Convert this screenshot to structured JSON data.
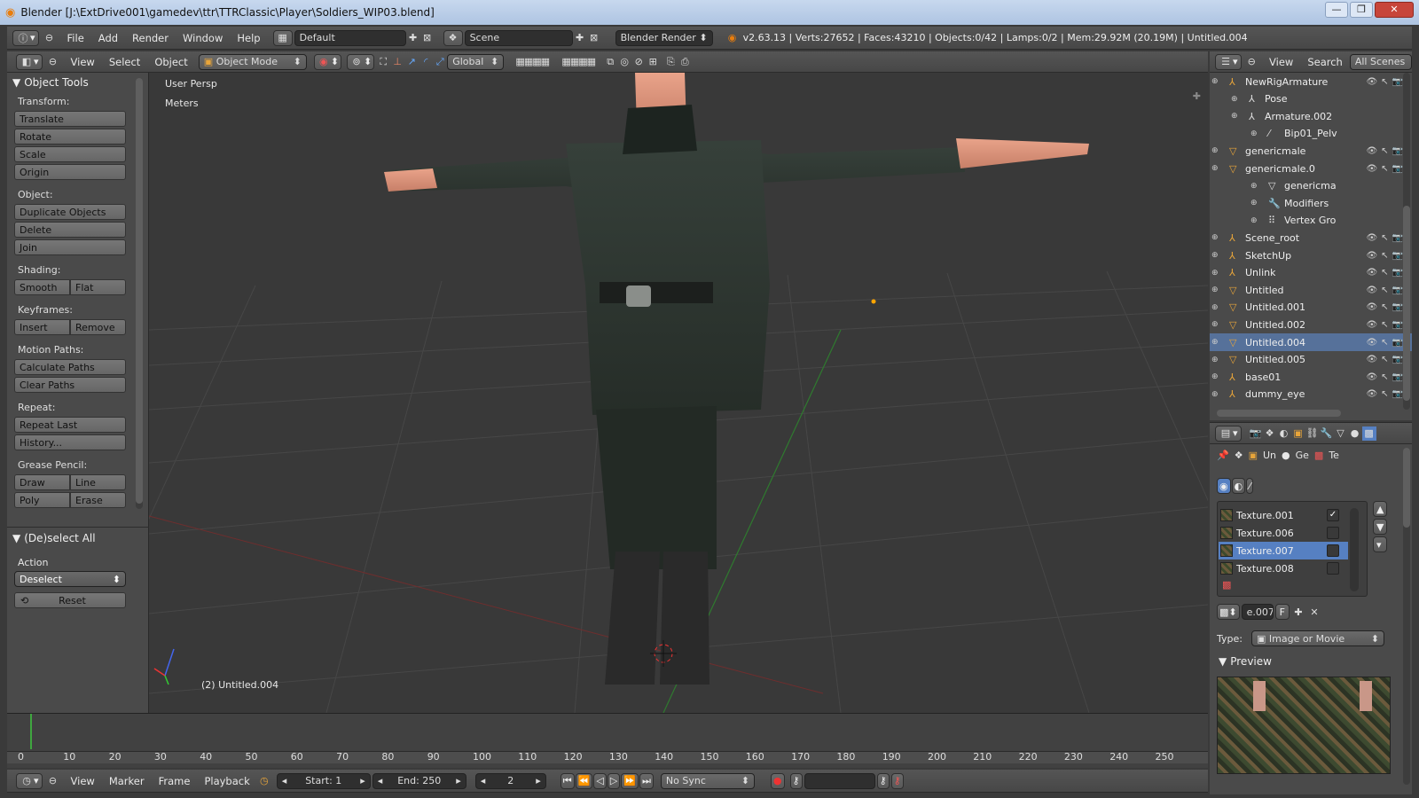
{
  "window": {
    "title": "Blender [J:\\ExtDrive001\\gamedev\\ttr\\TTRClassic\\Player\\Soldiers_WIP03.blend]",
    "minimize": "—",
    "maximize": "❐",
    "close": "✕"
  },
  "infobar": {
    "menus": [
      "File",
      "Add",
      "Render",
      "Window",
      "Help"
    ],
    "layout": "Default",
    "scene": "Scene",
    "engine": "Blender Render",
    "stats": "v2.63.13 | Verts:27652 | Faces:43210 | Objects:0/42 | Lamps:0/2 | Mem:29.92M (20.19M) | Untitled.004"
  },
  "viewheader": {
    "menus": [
      "View",
      "Select",
      "Object"
    ],
    "mode": "Object Mode",
    "orientation": "Global"
  },
  "toolshelf": {
    "title": "Object Tools",
    "sections": [
      {
        "label": "Transform:",
        "rows": [
          [
            "Translate"
          ],
          [
            "Rotate"
          ],
          [
            "Scale"
          ],
          [
            "Origin"
          ]
        ]
      },
      {
        "label": "Object:",
        "rows": [
          [
            "Duplicate Objects"
          ],
          [
            "Delete"
          ],
          [
            "Join"
          ]
        ]
      },
      {
        "label": "Shading:",
        "rows": [
          [
            "Smooth",
            "Flat"
          ]
        ]
      },
      {
        "label": "Keyframes:",
        "rows": [
          [
            "Insert",
            "Remove"
          ]
        ]
      },
      {
        "label": "Motion Paths:",
        "rows": [
          [
            "Calculate Paths"
          ],
          [
            "Clear Paths"
          ]
        ]
      },
      {
        "label": "Repeat:",
        "rows": [
          [
            "Repeat Last"
          ],
          [
            "History..."
          ]
        ]
      },
      {
        "label": "Grease Pencil:",
        "rows": [
          [
            "Draw",
            "Line"
          ],
          [
            "Poly",
            "Erase"
          ]
        ]
      }
    ],
    "op_title": "(De)select All",
    "action_label": "Action",
    "action_value": "Deselect",
    "reset": "Reset"
  },
  "viewport": {
    "view_name": "User Persp",
    "units": "Meters",
    "object_label": "(2) Untitled.004"
  },
  "timeline": {
    "ticks": [
      "0",
      "10",
      "20",
      "30",
      "40",
      "50",
      "60",
      "70",
      "80",
      "90",
      "100",
      "110",
      "120",
      "130",
      "140",
      "150",
      "160",
      "170",
      "180",
      "190",
      "200",
      "210",
      "220",
      "230",
      "240",
      "250"
    ],
    "menus": [
      "View",
      "Marker",
      "Frame",
      "Playback"
    ],
    "start": "Start: 1",
    "end": "End: 250",
    "current": "2",
    "sync": "No Sync"
  },
  "outliner": {
    "menus": [
      "View",
      "Search"
    ],
    "filter": "All Scenes",
    "rows": [
      {
        "label": "NewRigArmature",
        "indent": 0,
        "icon": "armature"
      },
      {
        "label": "Pose",
        "indent": 1,
        "icon": "pose"
      },
      {
        "label": "Armature.002",
        "indent": 1,
        "icon": "armature-data"
      },
      {
        "label": "Bip01_Pelv",
        "indent": 2,
        "icon": "bone"
      },
      {
        "label": "genericmale",
        "indent": 0,
        "icon": "mesh"
      },
      {
        "label": "genericmale.0",
        "indent": 0,
        "icon": "mesh"
      },
      {
        "label": "genericma",
        "indent": 2,
        "icon": "mesh-data"
      },
      {
        "label": "Modifiers",
        "indent": 2,
        "icon": "wrench"
      },
      {
        "label": "Vertex Gro",
        "indent": 2,
        "icon": "vgroup"
      },
      {
        "label": "Scene_root",
        "indent": 0,
        "icon": "empty"
      },
      {
        "label": "SketchUp",
        "indent": 0,
        "icon": "empty"
      },
      {
        "label": "Unlink",
        "indent": 0,
        "icon": "empty"
      },
      {
        "label": "Untitled",
        "indent": 0,
        "icon": "mesh"
      },
      {
        "label": "Untitled.001",
        "indent": 0,
        "icon": "mesh"
      },
      {
        "label": "Untitled.002",
        "indent": 0,
        "icon": "mesh"
      },
      {
        "label": "Untitled.004",
        "indent": 0,
        "icon": "mesh",
        "selected": true
      },
      {
        "label": "Untitled.005",
        "indent": 0,
        "icon": "mesh"
      },
      {
        "label": "base01",
        "indent": 0,
        "icon": "empty"
      },
      {
        "label": "dummy_eye",
        "indent": 0,
        "icon": "empty"
      }
    ]
  },
  "properties": {
    "breadcrumb": [
      "Un",
      "Ge",
      "Te"
    ],
    "textures": [
      {
        "name": "Texture.001",
        "checked": true
      },
      {
        "name": "Texture.006",
        "checked": false
      },
      {
        "name": "Texture.007",
        "checked": false,
        "selected": true
      },
      {
        "name": "Texture.008",
        "checked": false
      }
    ],
    "tex_name": "e.007",
    "tex_f": "F",
    "type_label": "Type:",
    "type_value": "Image or Movie",
    "preview_title": "Preview"
  }
}
